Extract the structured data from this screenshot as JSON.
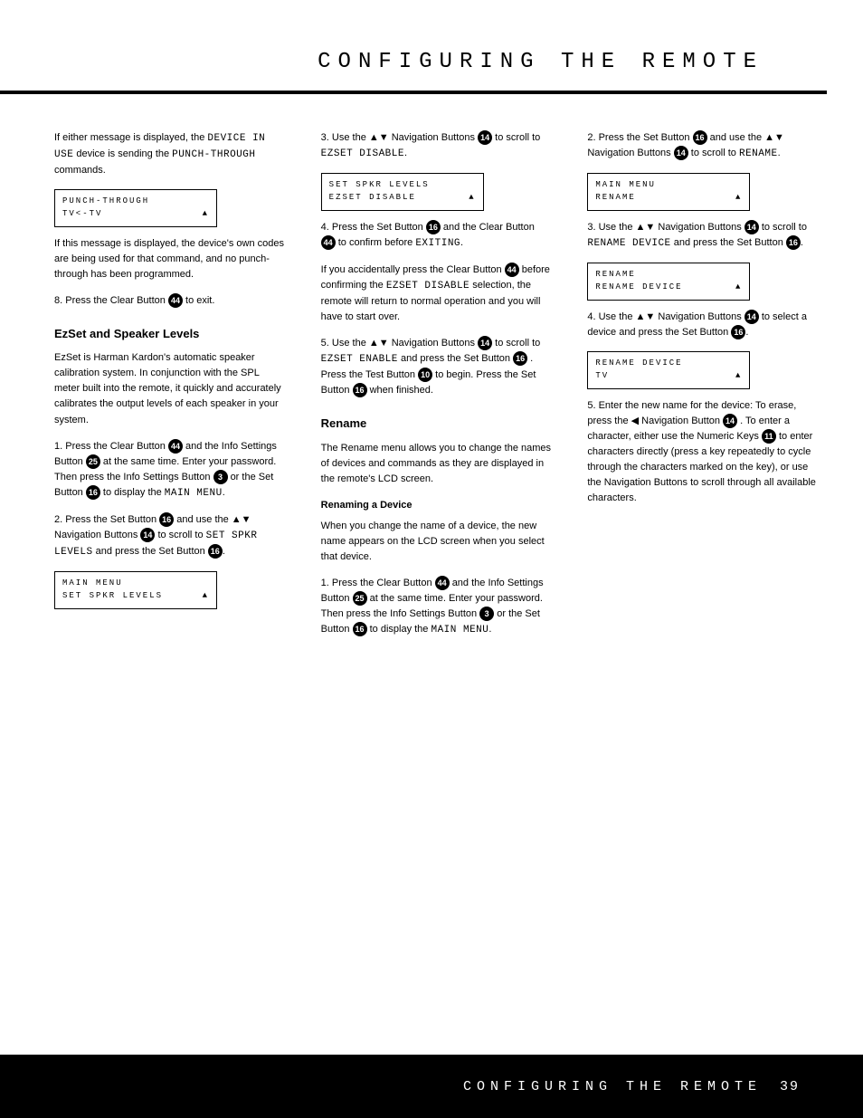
{
  "header": {
    "title": "CONFIGURING THE REMOTE"
  },
  "footer": {
    "title": "CONFIGURING THE REMOTE",
    "page": "39"
  },
  "col1": {
    "p1a": "If either message is displayed, the ",
    "p1b": "DEVICE IN USE",
    "p1c": " device is sending the ",
    "p1d": "PUNCH-THROUGH",
    "p1e": " commands.",
    "lcd1_line1": "PUNCH-THROUGH",
    "lcd1_line2": "TV<-TV",
    "p2": "If this message is displayed, the device's own codes are being used for that command, and no punch-through has been programmed.",
    "p3a": "8. Press the Clear Button ",
    "p3b": " to exit.",
    "h1": "EzSet and Speaker Levels",
    "p4": "EzSet is Harman Kardon's automatic speaker calibration system. In conjunction with the SPL meter built into the remote, it quickly and accurately calibrates the output levels of each speaker in your system.",
    "p5a": "1. Press the Clear Button ",
    "p5b": " and the Info Settings Button ",
    "p5c": " at the same time. Enter your password. Then press the Info Settings Button ",
    "p5d": " or the Set Button ",
    "p5e": " to display the ",
    "p5f": "MAIN MENU",
    "p5g": ".",
    "p6a": "2. Press the Set Button ",
    "p6b": " and use the ▲▼ Navigation Buttons ",
    "p6c": " to scroll to ",
    "p6d": "SET SPKR LEVELS",
    "p6e": " and press the Set Button ",
    "p6f": ".",
    "lcd2_line1": "MAIN MENU",
    "lcd2_line2": "SET SPKR LEVELS"
  },
  "col2": {
    "p1a": "3. Use the ▲▼ Navigation Buttons ",
    "p1b": " to scroll to ",
    "p1c": "EZSET DISABLE",
    "p1d": ".",
    "lcd1_line1": "SET SPKR LEVELS",
    "lcd1_line2": "EZSET DISABLE",
    "p2a": "4. Press the Set Button ",
    "p2b": " and the Clear Button ",
    "p2c": " to confirm before ",
    "p2d": "EXITING",
    "p2e": ".",
    "p3a": "If you accidentally press the Clear Button ",
    "p3b": " before confirming the ",
    "p3c": "EZSET DISABLE",
    "p3d": " selection, the remote will return to normal operation and you will have to start over.",
    "p4a": "5. Use the ▲▼ Navigation Buttons ",
    "p4b": " to scroll to ",
    "p4c": "EZSET ENABLE",
    "p4d": " and press the Set Button ",
    "p4e": ". Press the Test Button ",
    "p4f": " to begin. Press the Set Button ",
    "p4g": " when finished.",
    "h1": "Rename",
    "p5": "The Rename menu allows you to change the names of devices and commands as they are displayed in the remote's LCD screen.",
    "h2": "Renaming a Device",
    "p6": "When you change the name of a device, the new name appears on the LCD screen when you select that device.",
    "p7a": "1. Press the Clear Button ",
    "p7b": " and the Info Settings Button ",
    "p7c": " at the same time. Enter your password. Then press the Info Settings Button ",
    "p7d": " or the Set Button ",
    "p7e": " to display the ",
    "p7f": "MAIN MENU",
    "p7g": "."
  },
  "col3": {
    "p1a": "2. Press the Set Button ",
    "p1b": " and use the ▲▼ Navigation Buttons ",
    "p1c": " to scroll to ",
    "p1d": "RENAME",
    "p1e": ".",
    "lcd1_line1": "MAIN MENU",
    "lcd1_line2": "RENAME",
    "p2a": "3. Use the ▲▼ Navigation Buttons ",
    "p2b": " to scroll to ",
    "p2c": "RENAME DEVICE",
    "p2d": " and press the Set Button ",
    "p2e": ".",
    "lcd2_line1": "RENAME",
    "lcd2_line2": "RENAME DEVICE",
    "p3a": "4. Use the ▲▼ Navigation Buttons ",
    "p3b": " to select a device and press the Set Button ",
    "p3c": ".",
    "lcd3_line1": "RENAME DEVICE",
    "lcd3_line2": "TV",
    "p4a": "5. Enter the new name for the device: To erase, press the ◀ Navigation Button ",
    "p4b": ". To enter a character, either use the Numeric Keys ",
    "p4c": " to enter characters directly (press a key repeatedly to cycle through the characters marked on the key), or use the Navigation Buttons to scroll through all available characters."
  }
}
